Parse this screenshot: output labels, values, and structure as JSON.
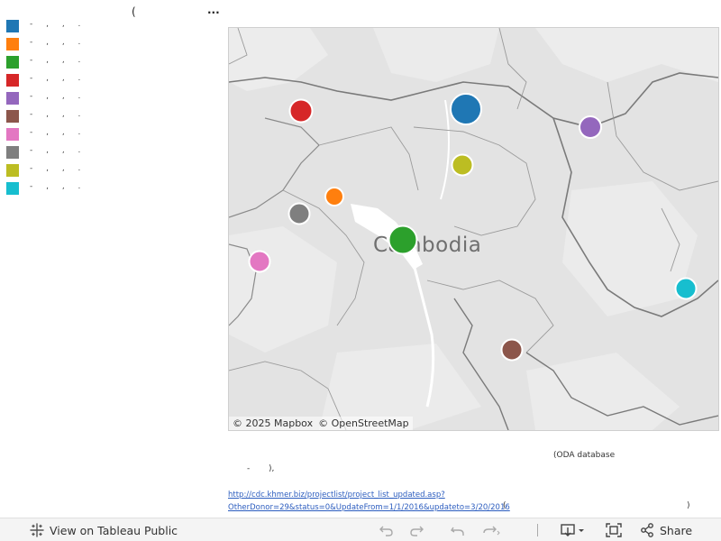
{
  "header": {
    "paren": "(",
    "more_label": "..."
  },
  "legend": {
    "items": [
      {
        "label": "- , , .",
        "color": "#1f77b4"
      },
      {
        "label": "- , , .",
        "color": "#ff7f0e"
      },
      {
        "label": "- , , .",
        "color": "#2ca02c"
      },
      {
        "label": "- , , .",
        "color": "#d62728"
      },
      {
        "label": "- , , .",
        "color": "#9467bd"
      },
      {
        "label": "- , , .",
        "color": "#8c564b"
      },
      {
        "label": "- , , .",
        "color": "#e377c2"
      },
      {
        "label": "- , , .",
        "color": "#7f7f7f"
      },
      {
        "label": "- , , .",
        "color": "#bcbd22"
      },
      {
        "label": "- , , .",
        "color": "#17becf"
      }
    ]
  },
  "map": {
    "country_label": "Cambodia",
    "attribution_mapbox": "© 2025 Mapbox",
    "attribution_osm": "© OpenStreetMap",
    "markers": [
      {
        "series": 0,
        "color": "#1f77b4",
        "size": "largest"
      },
      {
        "series": 1,
        "color": "#ff7f0e",
        "size": "small"
      },
      {
        "series": 2,
        "color": "#2ca02c",
        "size": "large"
      },
      {
        "series": 3,
        "color": "#d62728",
        "size": "medium"
      },
      {
        "series": 4,
        "color": "#9467bd",
        "size": "medium"
      },
      {
        "series": 5,
        "color": "#8c564b",
        "size": "medium"
      },
      {
        "series": 6,
        "color": "#e377c2",
        "size": "medium"
      },
      {
        "series": 7,
        "color": "#7f7f7f",
        "size": "medium"
      },
      {
        "series": 8,
        "color": "#bcbd22",
        "size": "medium"
      },
      {
        "series": 9,
        "color": "#17becf",
        "size": "medium"
      }
    ]
  },
  "source": {
    "label": "(ODA database",
    "dash": "-",
    "close": "),",
    "link_text": "http://cdc.khmer.biz/projectlist/project_list_updated.asp?OtherDonor=29&status=0&UpdateFrom=1/1/2016&updateto=3/20/2016",
    "paren_open": "(",
    "paren_close": ")"
  },
  "toolbar": {
    "view_label": "View on Tableau Public",
    "share_label": "Share",
    "icons": [
      "view-tableau-icon",
      "undo-icon",
      "redo-icon",
      "revert-icon",
      "refresh-icon",
      "download-icon",
      "fullscreen-icon",
      "share-icon"
    ]
  }
}
